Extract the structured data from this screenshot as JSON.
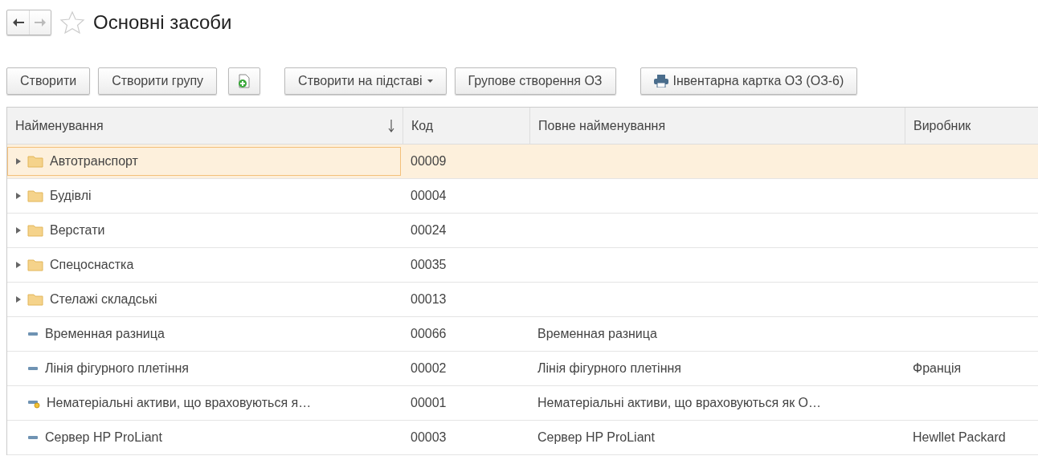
{
  "header": {
    "back": {
      "disabled": false
    },
    "forward": {
      "disabled": true
    },
    "favorite": {
      "on": false
    },
    "title": "Основні засоби"
  },
  "toolbar": [
    {
      "kind": "text",
      "label": "Створити"
    },
    {
      "kind": "text",
      "label": "Створити групу"
    },
    {
      "kind": "icon"
    },
    {
      "kind": "dropdown",
      "label": "Створити на підставі"
    },
    {
      "kind": "text",
      "label": "Групове створення ОЗ"
    },
    {
      "kind": "print",
      "label": "Інвентарна картка ОЗ (ОЗ-6)"
    }
  ],
  "table": {
    "columns": [
      {
        "label": "Найменування",
        "sorted": true
      },
      {
        "label": "Код",
        "sorted": false
      },
      {
        "label": "Повне найменування",
        "sorted": false
      },
      {
        "label": "Виробник",
        "sorted": false
      }
    ],
    "rows": [
      {
        "kind": "group",
        "selected": true,
        "name": "Автотранспорт",
        "code": "00009"
      },
      {
        "kind": "group",
        "selected": false,
        "name": "Будівлі",
        "code": "00004"
      },
      {
        "kind": "group",
        "selected": false,
        "name": "Верстати",
        "code": "00024"
      },
      {
        "kind": "group",
        "selected": false,
        "name": "Спецоснастка",
        "code": "00035"
      },
      {
        "kind": "group",
        "selected": false,
        "name": "Стелажі складські",
        "code": "00013"
      },
      {
        "kind": "item",
        "selected": false,
        "name": "Временная разница",
        "code": "00066",
        "full_name": "Временная разница"
      },
      {
        "kind": "item",
        "selected": false,
        "name": "Лінія фігурного плетіння",
        "code": "00002",
        "full_name": "Лінія фігурного плетіння",
        "maker": "Франція"
      },
      {
        "kind": "flagged",
        "selected": false,
        "name": "Нематеріальні активи, що враховуються я…",
        "code": "00001",
        "full_name": "Нематеріальні активи, що враховуються як О…"
      },
      {
        "kind": "item",
        "selected": false,
        "name": "Сервер HP ProLiant",
        "code": "00003",
        "full_name": "Сервер HP ProLiant",
        "maker": "Hewllet Packard"
      }
    ]
  }
}
